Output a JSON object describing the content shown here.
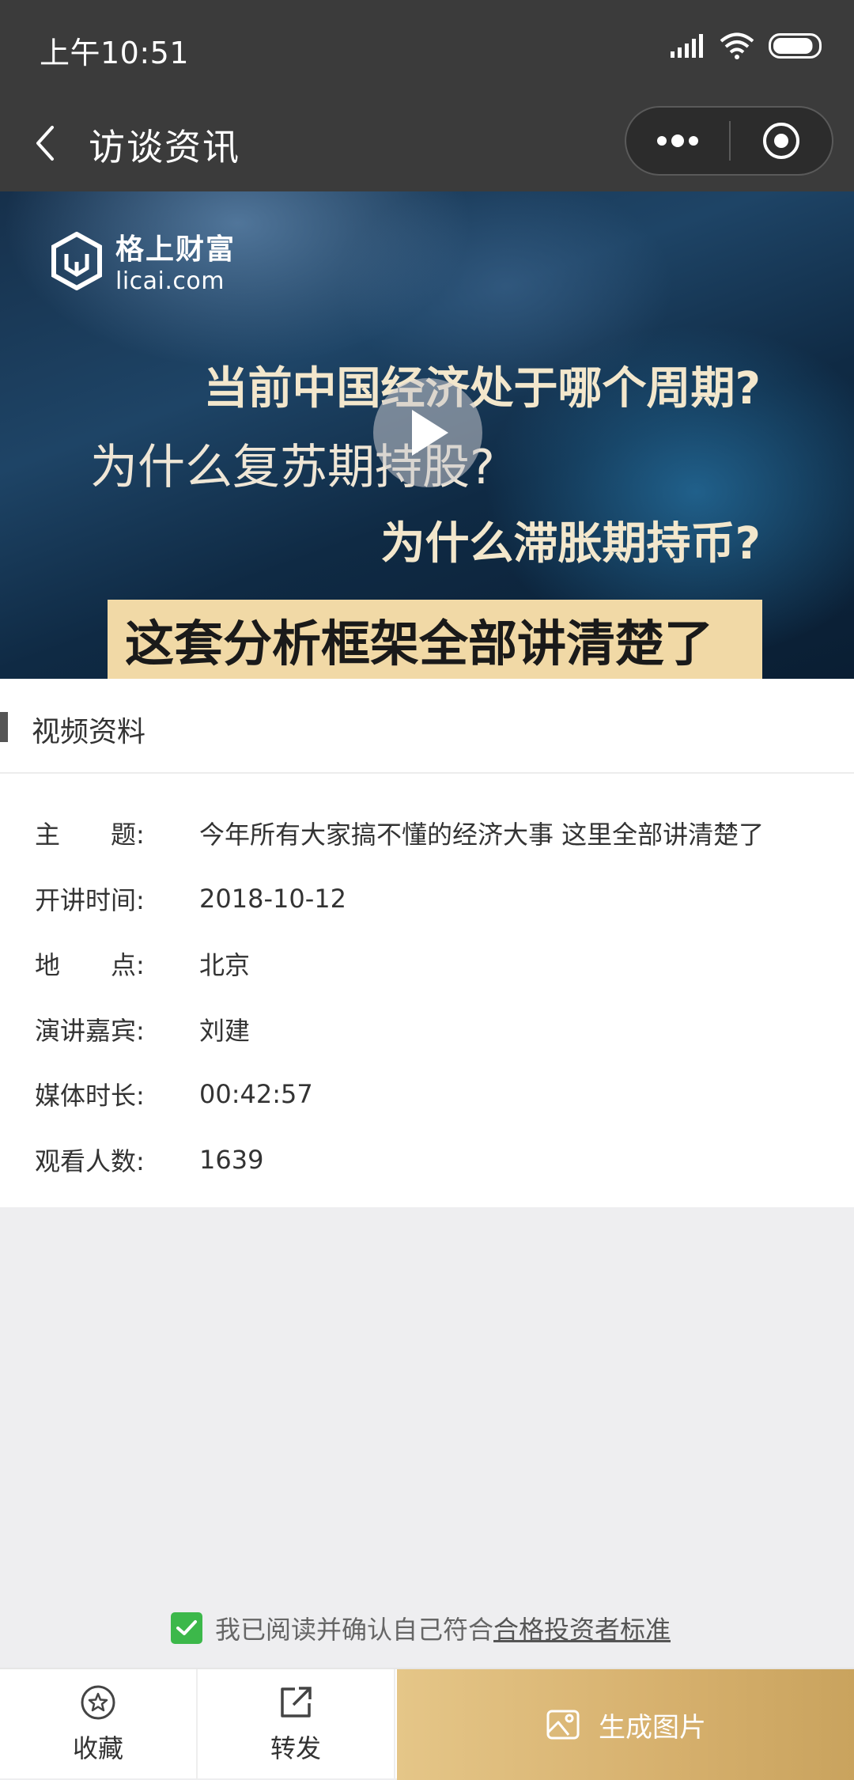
{
  "status_bar": {
    "time": "上午10:51",
    "battery_percent": 90
  },
  "nav": {
    "title": "访谈资讯"
  },
  "video": {
    "logo_cn": "格上财富",
    "logo_en": "licai.com",
    "line1": "当前中国经济处于哪个周期?",
    "line2": "为什么复苏期持股?",
    "line3": "为什么滞胀期持币?",
    "banner": "这套分析框架全部讲清楚了"
  },
  "section": {
    "title": "视频资料"
  },
  "info": {
    "rows": [
      {
        "label": "主　　题:",
        "value": "今年所有大家搞不懂的经济大事 这里全部讲清楚了"
      },
      {
        "label": "开讲时间:",
        "value": "2018-10-12"
      },
      {
        "label": "地　　点:",
        "value": "北京"
      },
      {
        "label": "演讲嘉宾:",
        "value": "刘建"
      },
      {
        "label": "媒体时长:",
        "value": "00:42:57"
      },
      {
        "label": "观看人数:",
        "value": "1639"
      }
    ]
  },
  "agreement": {
    "checked": true,
    "text": "我已阅读并确认自己符合",
    "link": "合格投资者标准"
  },
  "bottom": {
    "favorite": "收藏",
    "share": "转发",
    "generate": "生成图片"
  },
  "colors": {
    "nav_bg": "#3b3b3b",
    "banner_bg": "#f1d9a6",
    "check_green": "#3cb84a",
    "gold": "#d6b06d"
  }
}
